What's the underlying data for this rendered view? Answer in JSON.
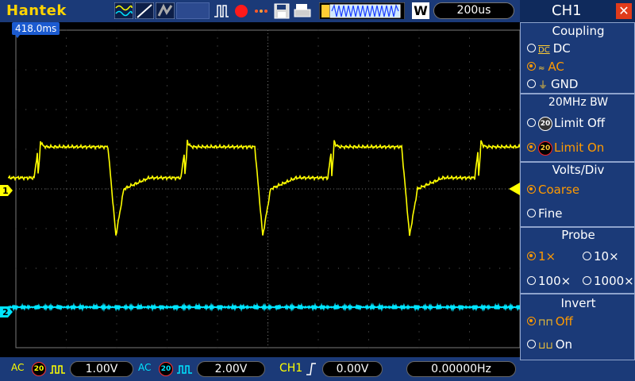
{
  "brand": "Hantek",
  "timebase": "200us",
  "trigger_time": "418.0ms",
  "top_icons": [
    "waveform-icon",
    "cursor-icon",
    "persistence-icon",
    "pulse-icon",
    "record-icon",
    "dots-icon",
    "save-icon",
    "print-icon",
    "acquire-icon"
  ],
  "acq_mode": "W",
  "markers": {
    "ch1": "1",
    "ch2": "2"
  },
  "bottom": {
    "ch1_coupling": "AC",
    "ch1_bw": "20",
    "ch1_scale": "1.00V",
    "ch2_coupling": "AC",
    "ch2_bw": "20",
    "ch2_scale": "2.00V",
    "trig_source": "CH1",
    "trig_level": "0.00V",
    "freq": "0.00000Hz"
  },
  "panel": {
    "title": "CH1",
    "coupling": {
      "title": "Coupling",
      "options": [
        "DC",
        "AC",
        "GND"
      ],
      "selected": "AC"
    },
    "bandwidth": {
      "title": "20MHz BW",
      "options": [
        "Limit Off",
        "Limit On"
      ],
      "selected": "Limit On"
    },
    "voltsdiv": {
      "title": "Volts/Div",
      "options": [
        "Coarse",
        "Fine"
      ],
      "selected": "Coarse"
    },
    "probe": {
      "title": "Probe",
      "options": [
        "1×",
        "10×",
        "100×",
        "1000×"
      ],
      "selected": "1×"
    },
    "invert": {
      "title": "Invert",
      "options": [
        "Off",
        "On"
      ],
      "selected": "Off"
    }
  },
  "colors": {
    "ch1": "#ffff00",
    "ch2": "#00e5ff",
    "panel": "#1b3a78",
    "selected": "#ff9a00"
  }
}
